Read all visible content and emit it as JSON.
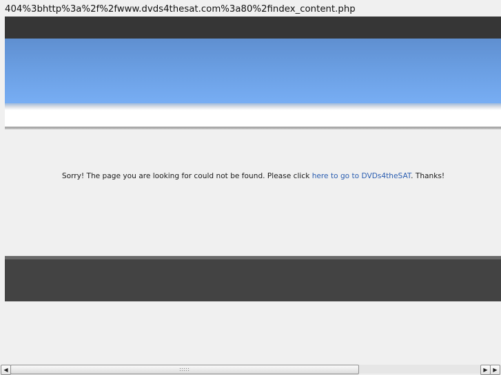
{
  "page": {
    "url_text": "404%3bhttp%3a%2f%2fwww.dvds4thesat.com%3a80%2findex_content.php"
  },
  "content": {
    "message_before": "Sorry! The page you are looking for could not be found. Please click ",
    "link_text": "here to go to DVDs4theSAT",
    "message_after": ". Thanks!"
  },
  "scrollbar": {
    "left_arrow": "◀",
    "right_arrow": "▶",
    "position_fraction": 0.0
  },
  "colors": {
    "header_bar": "#363636",
    "banner_top": "#5f8fd0",
    "banner_bottom": "#78aef4",
    "footer": "#434343",
    "link": "#2a5db0"
  }
}
